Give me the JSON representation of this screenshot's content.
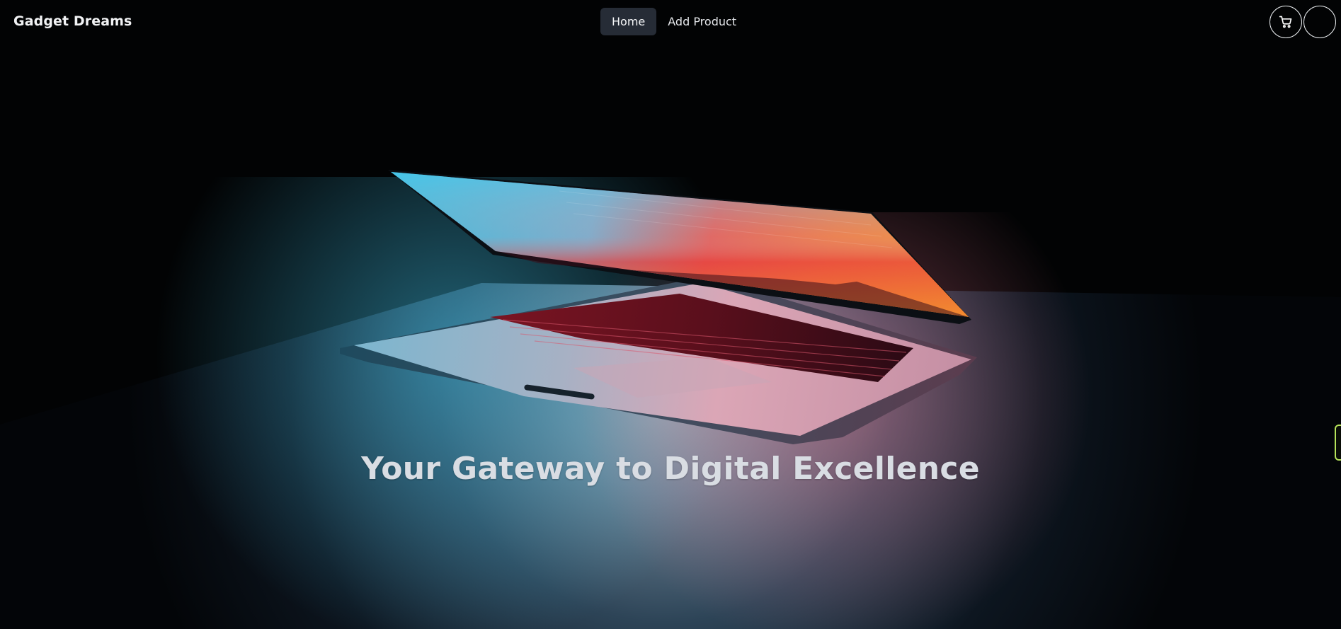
{
  "navbar": {
    "brand": "Gadget Dreams",
    "links": [
      {
        "label": "Home",
        "active": true
      },
      {
        "label": "Add Product",
        "active": false
      }
    ],
    "cart_icon": "shopping-cart-icon",
    "profile_icon": "user-avatar"
  },
  "hero": {
    "title": "Your Gateway to Digital Excellence",
    "image_subject": "open laptop glowing in the dark"
  },
  "colors": {
    "background": "#020304",
    "nav_active_bg": "#262c36",
    "text": "#f1f2f4",
    "title_text": "#d9dde3",
    "side_tab_border": "#b6e35a"
  }
}
